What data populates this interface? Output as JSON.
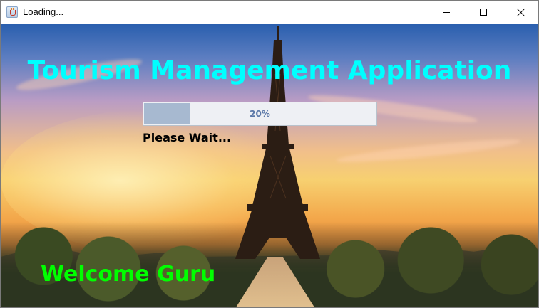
{
  "window": {
    "title": "Loading...",
    "app_icon": "java-coffee-cup-icon",
    "controls": [
      "minimize-icon",
      "maximize-icon",
      "close-icon"
    ]
  },
  "splash": {
    "headline": "Tourism Management Application",
    "progress": {
      "value": 20,
      "label": "20%"
    },
    "status_text": "Please Wait...",
    "welcome_text": "Welcome Guru",
    "background": "eiffel-tower-sunset-photo"
  },
  "colors": {
    "headline": "#00ffff",
    "welcome": "#00ff00",
    "progress_fill": "#a7b9d0",
    "progress_text": "#5b78a8"
  }
}
